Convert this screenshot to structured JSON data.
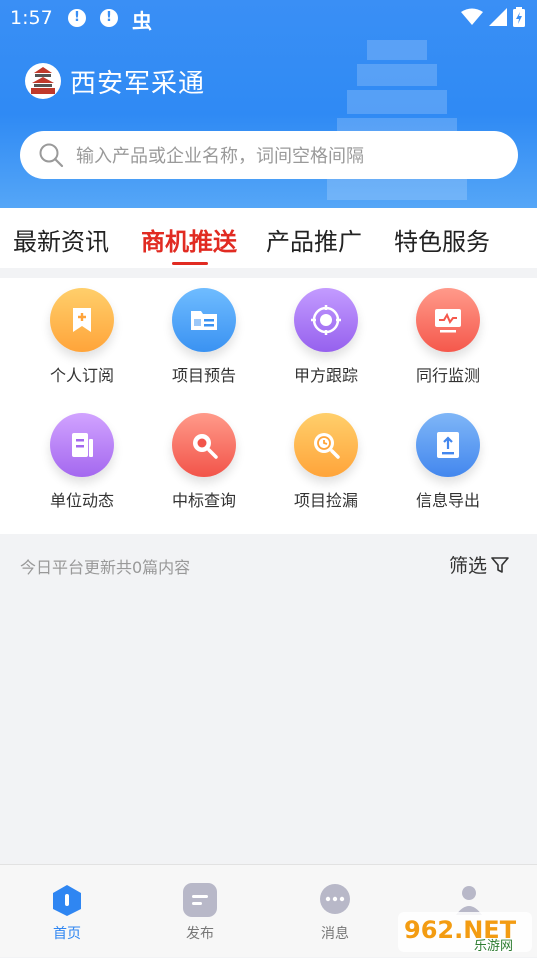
{
  "status_bar": {
    "time": "1:57",
    "notice_icon": "!",
    "bug_icon": "虫"
  },
  "header": {
    "app_title": "西安军采通"
  },
  "search": {
    "placeholder": "输入产品或企业名称，词间空格间隔"
  },
  "tabs": [
    {
      "label": "最新资讯",
      "active": false
    },
    {
      "label": "商机推送",
      "active": true
    },
    {
      "label": "产品推广",
      "active": false
    },
    {
      "label": "特色服务",
      "active": false
    }
  ],
  "features": [
    {
      "label": "个人订阅",
      "icon": "bookmark-plus-icon",
      "color": "#ffb54a"
    },
    {
      "label": "项目预告",
      "icon": "folder-notice-icon",
      "color": "#4aa3f7"
    },
    {
      "label": "甲方跟踪",
      "icon": "target-icon",
      "color": "#a372f2"
    },
    {
      "label": "同行监测",
      "icon": "monitor-icon",
      "color": "#fb6f62"
    },
    {
      "label": "单位动态",
      "icon": "document-icon",
      "color": "#b277f2"
    },
    {
      "label": "中标查询",
      "icon": "search-icon",
      "color": "#fb6d5d"
    },
    {
      "label": "项目捡漏",
      "icon": "magnifier-clock-icon",
      "color": "#ffb54a"
    },
    {
      "label": "信息导出",
      "icon": "export-icon",
      "color": "#4b9bf2"
    }
  ],
  "info": {
    "count_text": "今日平台更新共0篇内容",
    "filter_label": "筛选"
  },
  "bottom_nav": [
    {
      "label": "首页",
      "icon": "home-icon",
      "active": true
    },
    {
      "label": "发布",
      "icon": "publish-icon",
      "active": false
    },
    {
      "label": "消息",
      "icon": "message-icon",
      "active": false
    }
  ],
  "watermark": {
    "text": "962.NET",
    "subtext": "乐游网"
  },
  "colors": {
    "brand_blue": "#2f8af4",
    "active_red": "#e12b22",
    "nav_active": "#2f86f2"
  }
}
